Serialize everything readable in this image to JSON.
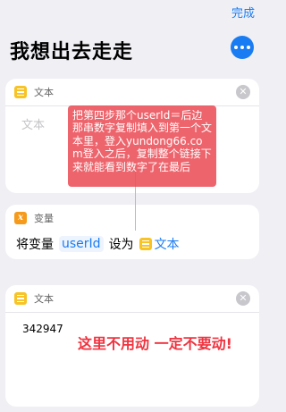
{
  "nav": {
    "done_label": "完成",
    "title": "我想出去走走"
  },
  "actions": [
    {
      "label": "文本",
      "icon": "text-icon",
      "placeholder": "文本"
    },
    {
      "label": "变量",
      "icon": "variable-icon",
      "row": {
        "prefix": "将变量",
        "var_name": "userId",
        "middle": "设为",
        "target": "文本"
      }
    },
    {
      "label": "文本",
      "icon": "text-icon",
      "value": "342947"
    }
  ],
  "annotations": {
    "note": "把第四步那个userId＝后边那串数字复制填入到第一个文本里，登入yundong66.com登入之后，复制整个链接下来就能看到数字了在最后",
    "warning": "这里不用动 一定不要动!"
  },
  "colors": {
    "accent": "#1a7cf2",
    "text_icon_bg": "#f7c325",
    "variable_icon_bg": "#f59a1b",
    "note_bg": "#ea4e58",
    "warning_text": "#f0333f"
  }
}
